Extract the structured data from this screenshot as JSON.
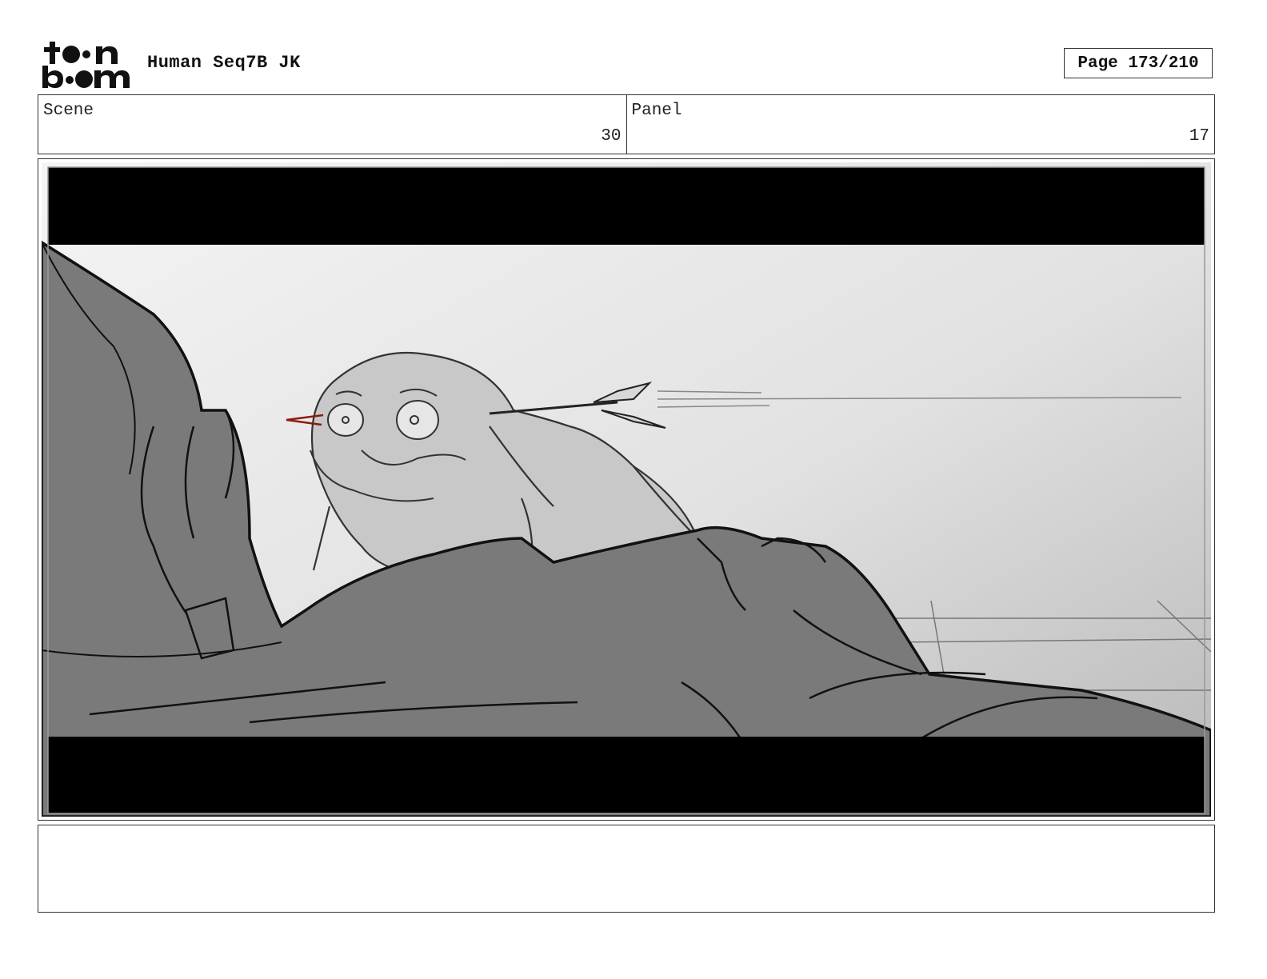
{
  "header": {
    "logo_text": "toon boom",
    "title": "Human Seq7B JK",
    "page_label": "Page 173/210"
  },
  "info": {
    "scene_label": "Scene",
    "scene_value": "30",
    "panel_label": "Panel",
    "panel_value": "17"
  },
  "panel": {
    "colors": {
      "letterbox": "#000000",
      "sky_light": "#f4f4f4",
      "sky_dark": "#b8b8b8",
      "character_dark": "#7a7a7a",
      "creature_light": "#c8c8c8",
      "blood_accent": "#8b1a10"
    }
  },
  "notes": {
    "text": ""
  }
}
